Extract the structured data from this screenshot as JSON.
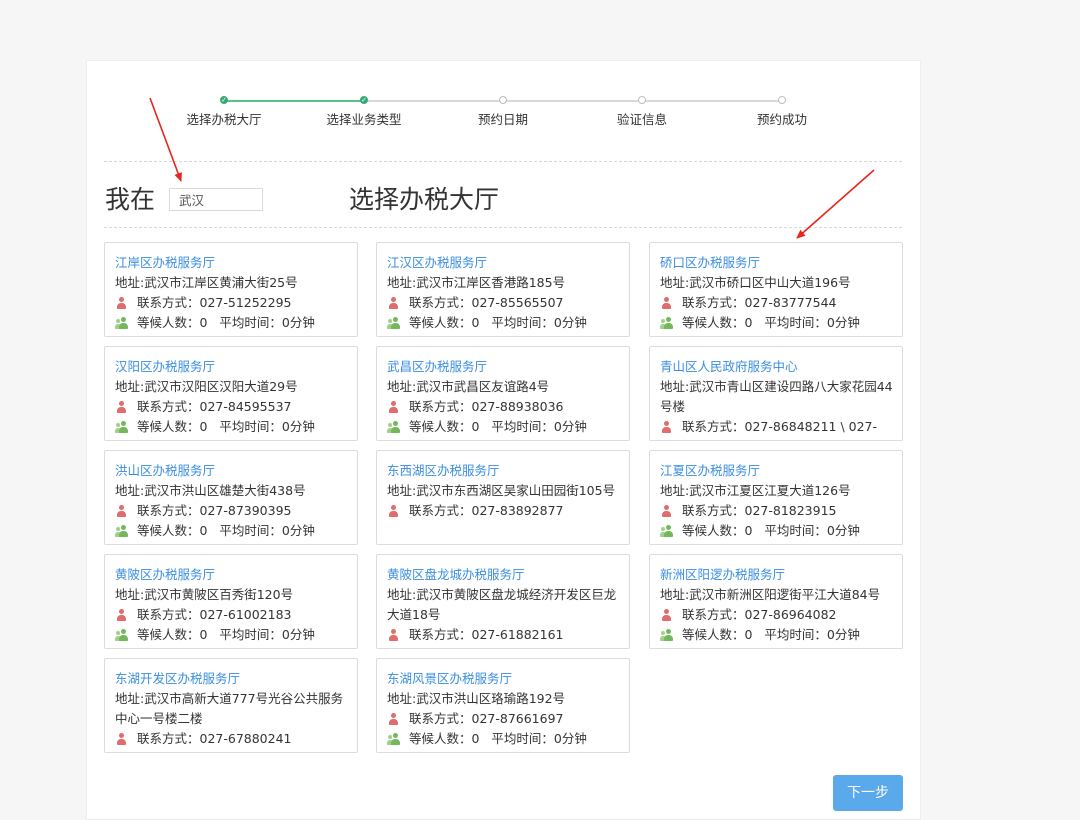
{
  "steps": [
    {
      "label": "选择办税大厅",
      "done": true
    },
    {
      "label": "选择业务类型",
      "done": true
    },
    {
      "label": "预约日期",
      "done": false
    },
    {
      "label": "验证信息",
      "done": false
    },
    {
      "label": "预约成功",
      "done": false
    }
  ],
  "location": {
    "label": "我在",
    "value": "武汉"
  },
  "page_title": "选择办税大厅",
  "offices": [
    {
      "name": "江岸区办税服务厅",
      "address": "地址:武汉市江岸区黄浦大街25号",
      "contact": "联系方式：027-51252295",
      "wait": "等候人数：0   平均时间：0分钟"
    },
    {
      "name": "江汉区办税服务厅",
      "address": "地址:武汉市江岸区香港路185号",
      "contact": "联系方式：027-85565507",
      "wait": "等候人数：0   平均时间：0分钟"
    },
    {
      "name": "硚口区办税服务厅",
      "address": "地址:武汉市硚口区中山大道196号",
      "contact": "联系方式：027-83777544",
      "wait": "等候人数：0   平均时间：0分钟"
    },
    {
      "name": "汉阳区办税服务厅",
      "address": "地址:武汉市汉阳区汉阳大道29号",
      "contact": "联系方式：027-84595537",
      "wait": "等候人数：0   平均时间：0分钟"
    },
    {
      "name": "武昌区办税服务厅",
      "address": "地址:武汉市武昌区友谊路4号",
      "contact": "联系方式：027-88938036",
      "wait": "等候人数：0   平均时间：0分钟"
    },
    {
      "name": "青山区人民政府服务中心",
      "address": "地址:武汉市青山区建设四路八大家花园44号楼",
      "contact": "联系方式：027-86848211 \\ 027-"
    },
    {
      "name": "洪山区办税服务厅",
      "address": "地址:武汉市洪山区雄楚大街438号",
      "contact": "联系方式：027-87390395",
      "wait": "等候人数：0   平均时间：0分钟"
    },
    {
      "name": "东西湖区办税服务厅",
      "address": "地址:武汉市东西湖区吴家山田园街105号",
      "contact": "联系方式：027-83892877"
    },
    {
      "name": "江夏区办税服务厅",
      "address": "地址:武汉市江夏区江夏大道126号",
      "contact": "联系方式：027-81823915",
      "wait": "等候人数：0   平均时间：0分钟"
    },
    {
      "name": "黄陂区办税服务厅",
      "address": "地址:武汉市黄陂区百秀街120号",
      "contact": "联系方式：027-61002183",
      "wait": "等候人数：0   平均时间：0分钟"
    },
    {
      "name": "黄陂区盘龙城办税服务厅",
      "address": "地址:武汉市黄陂区盘龙城经济开发区巨龙大道18号",
      "contact": "联系方式：027-61882161"
    },
    {
      "name": "新洲区阳逻办税服务厅",
      "address": "地址:武汉市新洲区阳逻街平江大道84号",
      "contact": "联系方式：027-86964082",
      "wait": "等候人数：0   平均时间：0分钟"
    },
    {
      "name": "东湖开发区办税服务厅",
      "address": "地址:武汉市高新大道777号光谷公共服务中心一号楼二楼",
      "contact": "联系方式：027-67880241"
    },
    {
      "name": "东湖风景区办税服务厅",
      "address": "地址:武汉市洪山区珞瑜路192号",
      "contact": "联系方式：027-87661697",
      "wait": "等候人数：0   平均时间：0分钟"
    }
  ],
  "next_button": "下一步",
  "colors": {
    "link": "#3a8ee0",
    "step_done": "#3aa876",
    "button": "#5aa9ea",
    "annotation": "#e8251f"
  },
  "icons": {
    "contact": "person-icon",
    "wait": "people-icon",
    "step_done": "check-icon"
  }
}
